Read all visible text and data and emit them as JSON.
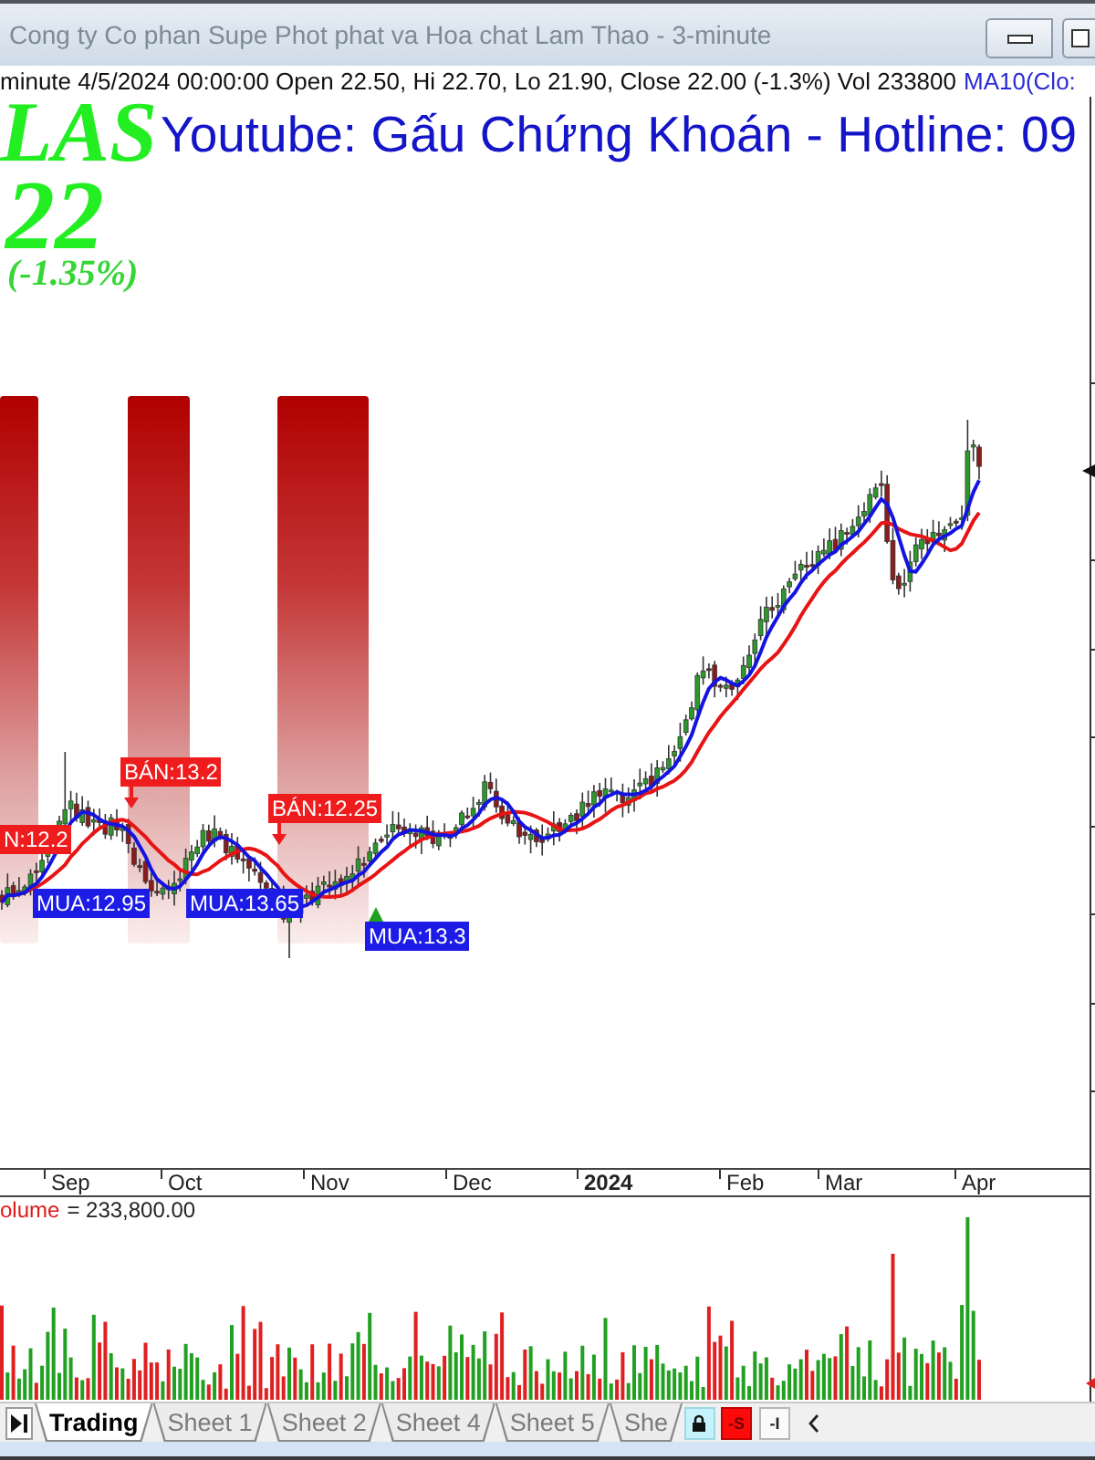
{
  "window": {
    "title": "Cong ty Co phan Supe Phot phat va Hoa chat Lam Thao - 3-minute"
  },
  "info_line": {
    "text": "minute 4/5/2024 00:00:00 Open 22.50, Hi 22.70, Lo 21.90, Close 22.00 (-1.3%) Vol 233800",
    "indicator": "MA10(Clo:"
  },
  "ticker": {
    "symbol": "LAS",
    "price": "22",
    "change": "(-1.35%)"
  },
  "banner": "Youtube: Gấu Chứng Khoán - Hotline: 09",
  "signals": [
    {
      "kind": "sell",
      "text": "N:12.2",
      "arrow": false
    },
    {
      "kind": "sell",
      "text": "BÁN:13.2",
      "arrow": true
    },
    {
      "kind": "sell",
      "text": "BÁN:12.25",
      "arrow": true
    },
    {
      "kind": "buy",
      "text": "MUA:12.95",
      "arrow": false
    },
    {
      "kind": "buy",
      "text": "MUA:13.65",
      "arrow": false
    },
    {
      "kind": "buy",
      "text": "MUA:13.3",
      "arrow": true
    }
  ],
  "x_axis": [
    {
      "label": "Sep",
      "kind": "month"
    },
    {
      "label": "Oct",
      "kind": "month"
    },
    {
      "label": "Nov",
      "kind": "month"
    },
    {
      "label": "Dec",
      "kind": "month"
    },
    {
      "label": "2024",
      "kind": "year"
    },
    {
      "label": "Feb",
      "kind": "month"
    },
    {
      "label": "Mar",
      "kind": "month"
    },
    {
      "label": "Apr",
      "kind": "month"
    }
  ],
  "volume": {
    "label": "olume",
    "value": "= 233,800.00"
  },
  "sheet_tabs": [
    {
      "label": "Trading",
      "selected": true
    },
    {
      "label": "Sheet 1",
      "selected": false
    },
    {
      "label": "Sheet 2",
      "selected": false
    },
    {
      "label": "Sheet 4",
      "selected": false
    },
    {
      "label": "Sheet 5",
      "selected": false
    },
    {
      "label": "She",
      "selected": false
    }
  ],
  "tab_tools": [
    {
      "label": "-S",
      "highlighted": true
    },
    {
      "label": "-I",
      "highlighted": false
    }
  ]
}
